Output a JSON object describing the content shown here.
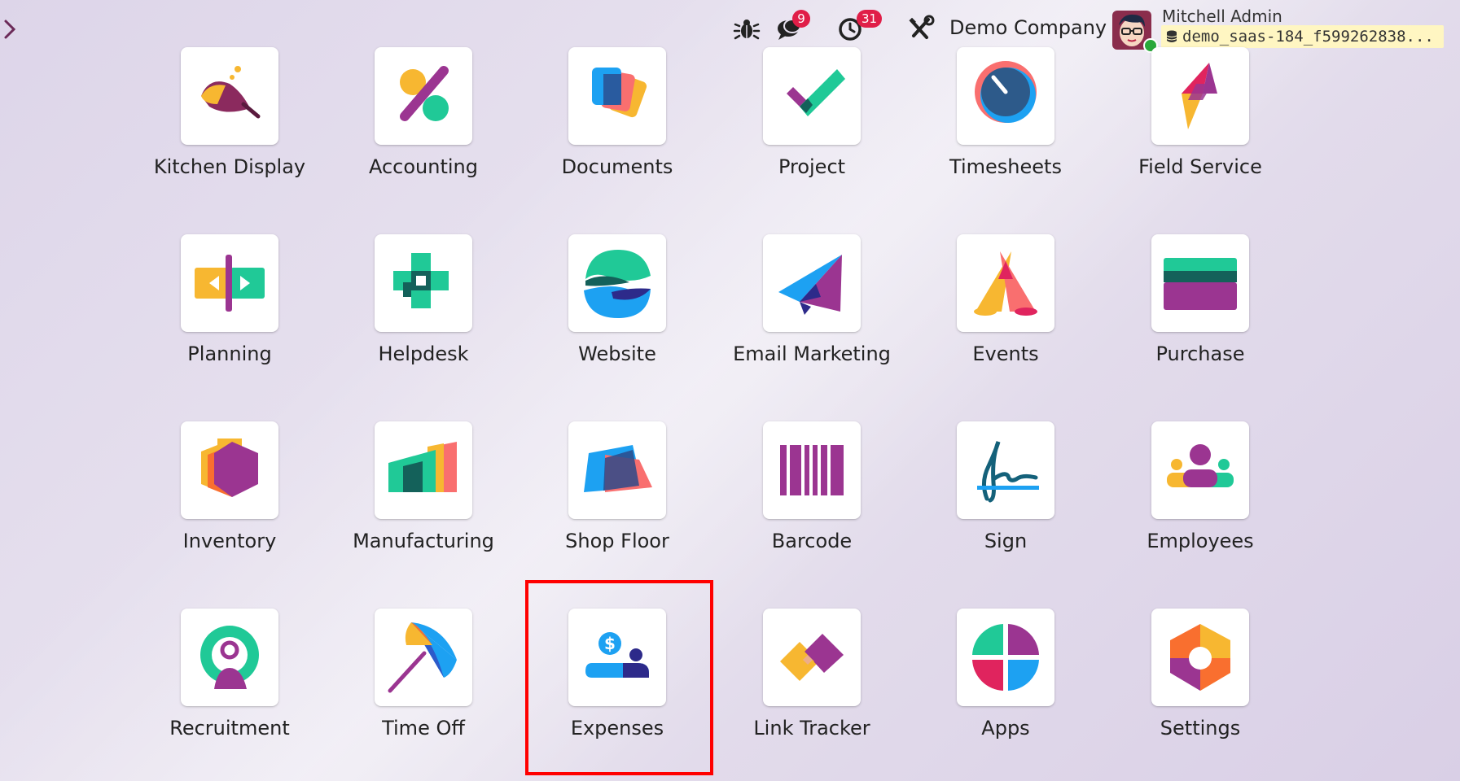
{
  "topbar": {
    "toggle_icon": "chevron-right-icon",
    "icons": {
      "debug": "bug-icon",
      "messages": "chat-bubbles-icon",
      "activities": "clock-icon",
      "tools": "wrench-screwdriver-icon"
    },
    "messages_count": "9",
    "activities_count": "31",
    "company": "Demo Company",
    "user_name": "Mitchell Admin",
    "database": "demo_saas-184_f599262838...",
    "status_color": "#2aa83a",
    "badge_color": "#e01e48"
  },
  "apps": [
    {
      "label": "Kitchen Display",
      "icon": "kitchen-display-icon"
    },
    {
      "label": "Accounting",
      "icon": "accounting-icon"
    },
    {
      "label": "Documents",
      "icon": "documents-icon"
    },
    {
      "label": "Project",
      "icon": "project-icon"
    },
    {
      "label": "Timesheets",
      "icon": "timesheets-icon"
    },
    {
      "label": "Field Service",
      "icon": "field-service-icon"
    },
    {
      "label": "Planning",
      "icon": "planning-icon"
    },
    {
      "label": "Helpdesk",
      "icon": "helpdesk-icon"
    },
    {
      "label": "Website",
      "icon": "website-icon"
    },
    {
      "label": "Email Marketing",
      "icon": "email-marketing-icon"
    },
    {
      "label": "Events",
      "icon": "events-icon"
    },
    {
      "label": "Purchase",
      "icon": "purchase-icon"
    },
    {
      "label": "Inventory",
      "icon": "inventory-icon"
    },
    {
      "label": "Manufacturing",
      "icon": "manufacturing-icon"
    },
    {
      "label": "Shop Floor",
      "icon": "shop-floor-icon"
    },
    {
      "label": "Barcode",
      "icon": "barcode-icon"
    },
    {
      "label": "Sign",
      "icon": "sign-icon"
    },
    {
      "label": "Employees",
      "icon": "employees-icon"
    },
    {
      "label": "Recruitment",
      "icon": "recruitment-icon"
    },
    {
      "label": "Time Off",
      "icon": "time-off-icon"
    },
    {
      "label": "Expenses",
      "icon": "expenses-icon"
    },
    {
      "label": "Link Tracker",
      "icon": "link-tracker-icon"
    },
    {
      "label": "Apps",
      "icon": "apps-icon"
    },
    {
      "label": "Settings",
      "icon": "settings-icon"
    }
  ],
  "highlighted_app": "Expenses",
  "highlight_color": "#ff0000"
}
